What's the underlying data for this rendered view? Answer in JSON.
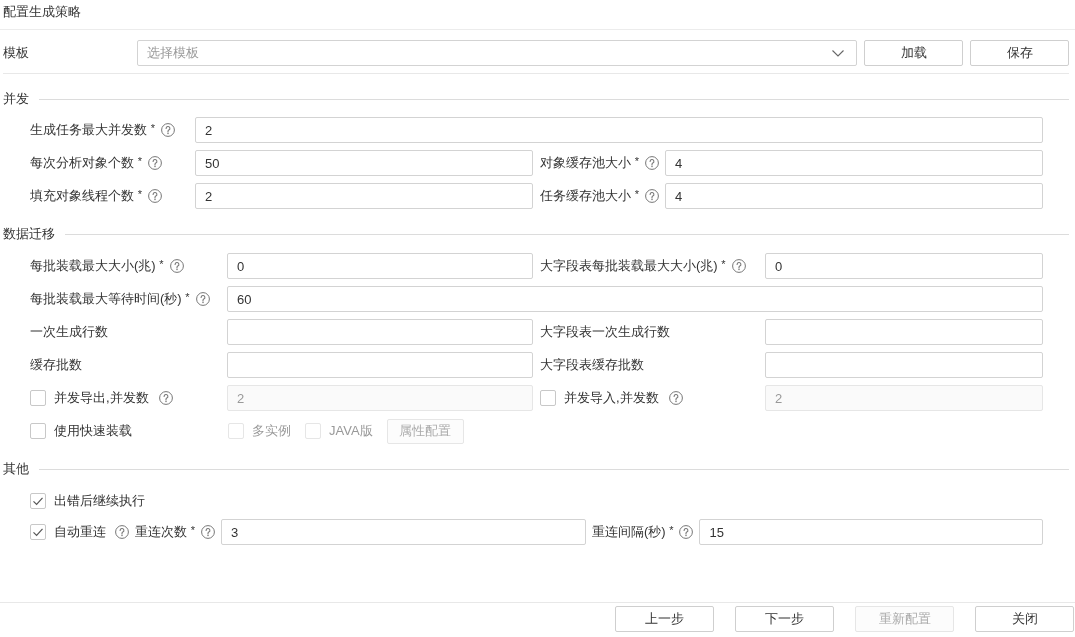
{
  "dialog": {
    "title": "配置生成策略"
  },
  "template": {
    "label": "模板",
    "placeholder": "选择模板",
    "buttons": [
      {
        "label": "加载",
        "disabled": false
      },
      {
        "label": "保存",
        "disabled": false
      }
    ]
  },
  "sections": [
    {
      "title": "并发",
      "rows": [
        {
          "kind": "fields",
          "fields": [
            {
              "label": "生成任务最大并发数 $^{*}$",
              "help": true,
              "value": "2",
              "disabled": false
            }
          ]
        },
        {
          "kind": "fields",
          "fields": [
            {
              "label": "每次分析对象个数 $^{*}$",
              "help": true,
              "value": "50",
              "disabled": false
            },
            {
              "label": "对象缓存池大小 $^{*}$",
              "help": true,
              "value": "4",
              "disabled": false
            }
          ]
        },
        {
          "kind": "fields",
          "fields": [
            {
              "label": "填充对象线程个数 $^{*}$",
              "help": true,
              "value": "2",
              "disabled": false
            },
            {
              "label": "任务缓存池大小 $^{*}$",
              "help": true,
              "value": "4",
              "disabled": false
            }
          ]
        }
      ]
    },
    {
      "title": "数据迁移",
      "rows": [
        {
          "kind": "fields",
          "fields": [
            {
              "label": "每批装载最大大小(兆) $^{*}$",
              "help": true,
              "value": "0",
              "disabled": false
            },
            {
              "label": "大字段表每批装载最大大小(兆) $^{*}$",
              "help": true,
              "value": "0",
              "disabled": false
            }
          ]
        },
        {
          "kind": "fields",
          "fields": [
            {
              "label": "每批装载最大等待时间(秒) $^{*}$",
              "help": true,
              "value": "60",
              "disabled": false
            }
          ]
        },
        {
          "kind": "fields",
          "fields": [
            {
              "label": "一次生成行数",
              "help": false,
              "disabled": false
            },
            {
              "label": "大字段表一次生成行数",
              "help": false,
              "disabled": false
            }
          ]
        },
        {
          "kind": "fields",
          "fields": [
            {
              "label": "缓存批数",
              "help": false,
              "disabled": false
            },
            {
              "label": "大字段表缓存批数",
              "help": false,
              "disabled": false
            }
          ]
        },
        {
          "kind": "toggle_fields",
          "fields": [
            {
              "label": "并发导出,并发数",
              "checked": false,
              "help": true,
              "value": "2",
              "disabled": true
            },
            {
              "label": "并发导入,并发数",
              "checked": false,
              "help": true,
              "value": "2",
              "disabled": true
            }
          ]
        },
        {
          "kind": "options",
          "checkbox": {
            "label": "使用快速装载",
            "checked": false
          },
          "sub_options": [
            {
              "label": "多实例",
              "checked": false,
              "disabled": true
            },
            {
              "label": "JAVA版",
              "checked": false,
              "disabled": true
            }
          ],
          "button": {
            "label": "属性配置",
            "disabled": true
          }
        }
      ]
    },
    {
      "title": "其他",
      "rows": [
        {
          "kind": "checkbox",
          "checkbox": {
            "label": "出错后继续执行",
            "checked": true
          }
        },
        {
          "kind": "inline",
          "checkbox": {
            "label": "自动重连",
            "checked": true,
            "help": true
          },
          "fields": [
            {
              "label": "重连次数 $^{*}$",
              "help": true,
              "value": "3",
              "disabled": false
            },
            {
              "label": "重连间隔(秒) $^{*}$",
              "help": true,
              "value": "15",
              "disabled": false
            }
          ]
        }
      ]
    }
  ],
  "footer": {
    "buttons": [
      {
        "label": "上一步",
        "disabled": false
      },
      {
        "label": "下一步",
        "disabled": false
      },
      {
        "label": "重新配置",
        "disabled": true
      },
      {
        "label": "关闭",
        "disabled": false
      }
    ]
  }
}
